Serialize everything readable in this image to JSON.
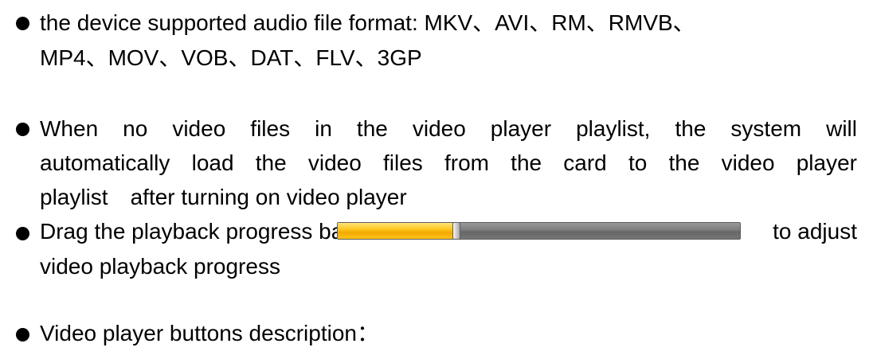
{
  "bullets": [
    {
      "lines": [
        "the device supported audio file format: MKV、AVI、RM、RMVB、",
        "MP4、MOV、VOB、DAT、FLV、3GP"
      ]
    },
    {
      "lines": [
        "When no video files in the video player playlist, the system will",
        "automatically load the video files from the card to the video player",
        "playlist　after turning on video player"
      ]
    },
    {
      "before_bar": "Drag the playback progress bar",
      "after_bar": "to adjust",
      "line2": "video playback progress",
      "progress_fraction": 0.29
    },
    {
      "lines": [
        "Video player buttons description："
      ]
    }
  ]
}
